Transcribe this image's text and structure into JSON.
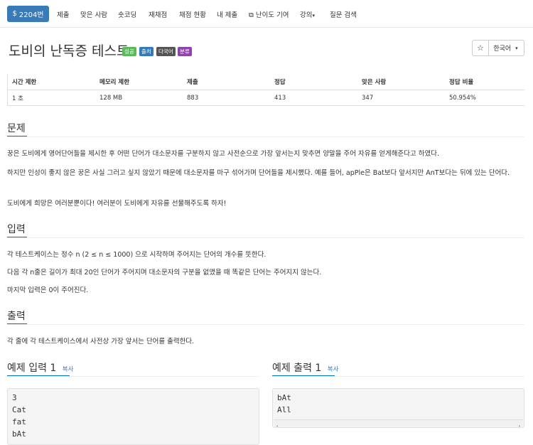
{
  "nav": {
    "brand": "2204번",
    "items": [
      "제출",
      "맞은 사람",
      "숏코딩",
      "재채점",
      "채점 현황",
      "내 제출",
      "난이도 기여",
      "강의",
      "질문 검색"
    ]
  },
  "title": "도비의 난독증 테스트",
  "labels": [
    {
      "text": "성공",
      "color": "#5cb85c"
    },
    {
      "text": "출처",
      "color": "#337ab7"
    },
    {
      "text": "다국어",
      "color": "#555555"
    },
    {
      "text": "분류",
      "color": "#8e44ad"
    }
  ],
  "language": "한국어",
  "info": {
    "headers": [
      "시간 제한",
      "메모리 제한",
      "제출",
      "정답",
      "맞은 사람",
      "정답 비율"
    ],
    "values": [
      "1 초",
      "128 MB",
      "883",
      "413",
      "347",
      "50.954%"
    ]
  },
  "sections": {
    "problem": "문제",
    "input": "입력",
    "output": "출력",
    "sample_input": "예제 입력 1",
    "sample_output": "예제 출력 1",
    "copy": "복사"
  },
  "problem_text": [
    "꿍은 도비에게 영어단어들을 제시한 후 어떤 단어가 대소문자를 구분하지 않고 사전순으로 가장 앞서는지 맞추면 양말을 주어 자유를 얻게해준다고 하였다.",
    "하지만 인성이 좋지 않은 꿍은 사실 그러고 싶지 않았기 때문에 대소문자를 마구 섞어가며 단어들을 제시했다. 예를 들어, apPle은 Bat보다 앞서지만 AnT보다는 뒤에 있는 단어다.",
    "도비에게 희망은 여러분뿐이다! 여러분이 도비에게 자유를 선물해주도록 하자!"
  ],
  "input_text": [
    "각 테스트케이스는 정수 n (2 ≤ n ≤ 1000) 으로 시작하며 주어지는 단어의 개수를 뜻한다.",
    "다음 각 n줄은 길이가 최대 20인 단어가 주어지며 대소문자의 구분을 없앴을 때 똑같은 단어는 주어지지 않는다.",
    "마지막 입력은 0이 주어진다."
  ],
  "output_text": [
    "각 줄에 각 테스트케이스에서 사전상 가장 앞서는 단어를 출력한다."
  ],
  "sample_input_lines": [
    "3",
    "Cat",
    "fat",
    "bAt"
  ],
  "sample_output_lines": [
    "bAt",
    "All"
  ]
}
